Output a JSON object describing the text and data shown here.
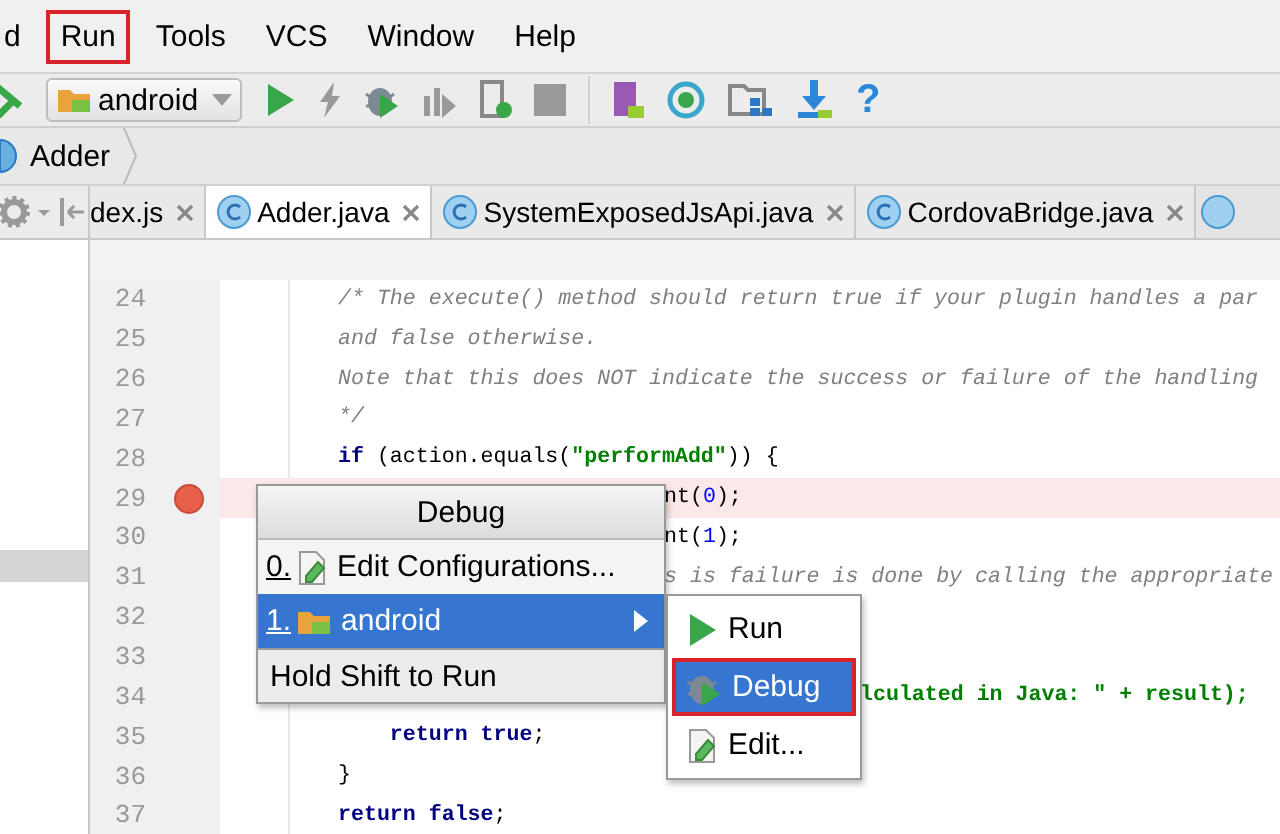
{
  "menu_bar": [
    {
      "label": "d",
      "annotated": false
    },
    {
      "label": "Run",
      "annotated": true
    },
    {
      "label": "Tools",
      "annotated": false
    },
    {
      "label": "VCS",
      "annotated": false
    },
    {
      "label": "Window",
      "annotated": false
    },
    {
      "label": "Help",
      "annotated": false
    }
  ],
  "toolbar": {
    "run_config": "android",
    "help": "?"
  },
  "breadcrumb": [
    "Adder"
  ],
  "tabs": [
    {
      "label": "dex.js",
      "selected": false
    },
    {
      "label": "Adder.java",
      "selected": true
    },
    {
      "label": "SystemExposedJsApi.java",
      "selected": false
    },
    {
      "label": "CordovaBridge.java",
      "selected": false
    }
  ],
  "project_panel": {
    "selection_visible": true
  },
  "editor": {
    "lines": [
      {
        "number": "24",
        "breakpoint": false,
        "highlighted": false,
        "segments": [
          {
            "text": "/* The execute() method should return true if your plugin handles a par",
            "kind": "comment"
          }
        ]
      },
      {
        "number": "25",
        "breakpoint": false,
        "highlighted": false,
        "segments": [
          {
            "text": "and false otherwise.",
            "kind": "comment"
          }
        ]
      },
      {
        "number": "26",
        "breakpoint": false,
        "highlighted": false,
        "segments": [
          {
            "text": "Note that this does NOT indicate the success or failure of the handling",
            "kind": "comment"
          }
        ]
      },
      {
        "number": "27",
        "breakpoint": false,
        "highlighted": false,
        "segments": [
          {
            "text": "*/",
            "kind": "comment"
          }
        ]
      },
      {
        "number": "28",
        "breakpoint": false,
        "highlighted": false,
        "segments": [
          {
            "text": "if",
            "kind": "keyword"
          },
          {
            "text": " (action.equals(",
            "kind": "plain"
          },
          {
            "text": "\"performAdd\"",
            "kind": "string"
          },
          {
            "text": ")) {",
            "kind": "plain"
          }
        ]
      },
      {
        "number": "29",
        "breakpoint": true,
        "highlighted": true,
        "segments": [
          {
            "text": "nt(",
            "kind": "plain"
          },
          {
            "text": "0",
            "kind": "number"
          },
          {
            "text": ");",
            "kind": "plain"
          }
        ]
      },
      {
        "number": "30",
        "breakpoint": false,
        "highlighted": false,
        "segments": [
          {
            "text": "nt(",
            "kind": "plain"
          },
          {
            "text": "1",
            "kind": "number"
          },
          {
            "text": ");",
            "kind": "plain"
          }
        ]
      },
      {
        "number": "31",
        "breakpoint": false,
        "highlighted": false,
        "segments": [
          {
            "text": "s is failure is done by calling the appropriate",
            "kind": "comment"
          }
        ]
      },
      {
        "number": "32",
        "breakpoint": false,
        "highlighted": false
      },
      {
        "number": "33",
        "breakpoint": false,
        "highlighted": false
      },
      {
        "number": "34",
        "breakpoint": false,
        "highlighted": false,
        "segments": [
          {
            "text": "lculated in Java: \" + result);",
            "kind": "string"
          }
        ]
      },
      {
        "number": "35",
        "breakpoint": false,
        "highlighted": false,
        "segments": [
          {
            "text": "    return true",
            "kind": "keyword"
          },
          {
            "text": ";",
            "kind": "plain"
          }
        ]
      },
      {
        "number": "36",
        "breakpoint": false,
        "highlighted": false,
        "segments": [
          {
            "text": "}",
            "kind": "plain"
          }
        ]
      },
      {
        "number": "37",
        "breakpoint": false,
        "highlighted": false,
        "segments": [
          {
            "text": "return false",
            "kind": "keyword"
          },
          {
            "text": ";",
            "kind": "plain"
          }
        ]
      }
    ]
  },
  "popup": {
    "title": "Debug",
    "items": [
      {
        "mnemonic": "0.",
        "label": "Edit Configurations...",
        "selected": false,
        "submenu": false
      },
      {
        "mnemonic": "1.",
        "label": "android",
        "selected": true,
        "submenu": true
      }
    ],
    "footer": "Hold Shift to Run"
  },
  "submenu": {
    "items": [
      {
        "label": "Run",
        "selected": false,
        "annotated": false
      },
      {
        "label": "Debug",
        "selected": true,
        "annotated": true
      },
      {
        "label": "Edit...",
        "selected": false,
        "annotated": false
      }
    ]
  }
}
